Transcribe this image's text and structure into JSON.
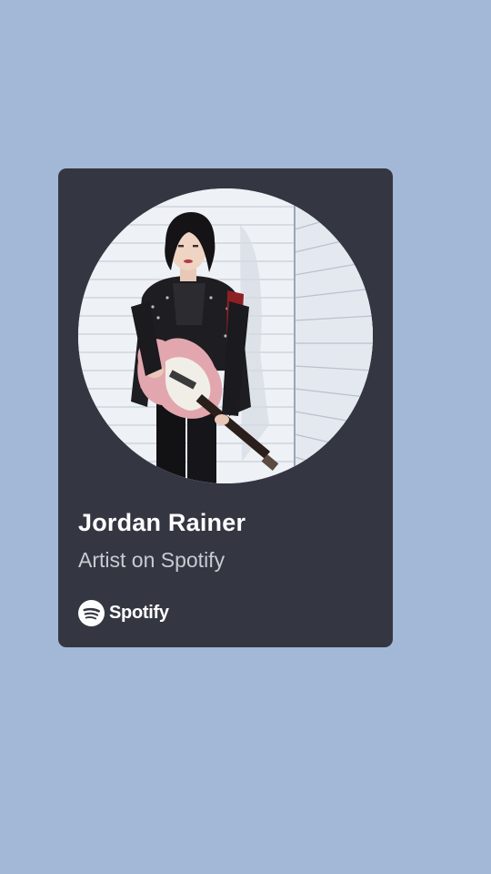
{
  "artist_card": {
    "name": "Jordan Rainer",
    "subtitle": "Artist on Spotify",
    "brand_label": "Spotify",
    "brand_icon": "spotify-icon",
    "photo_icon": "artist-photo"
  },
  "colors": {
    "background": "#a3b8d7",
    "card": "#343742",
    "title": "#ffffff",
    "subtitle": "#c9cbd1"
  }
}
